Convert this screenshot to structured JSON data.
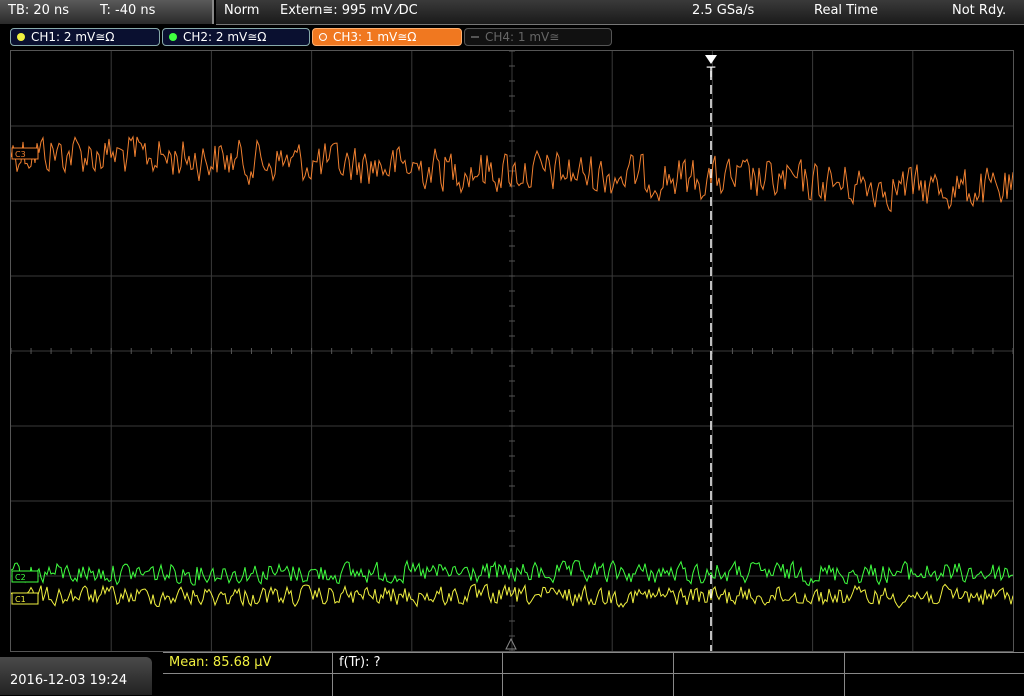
{
  "topbar": {
    "timebase": "TB: 20 ns",
    "trigger_time": "T: -40 ns",
    "trigger_mode": "Norm",
    "trigger_source": "Extern≅: 995 mV ⁄DC",
    "sample_rate": "2.5 GSa/s",
    "acquisition_mode": "Real Time",
    "ready_state": "Not Rdy."
  },
  "channels": [
    {
      "label": "CH1: 2 mV≅Ω",
      "color": "#f0f040",
      "active": true
    },
    {
      "label": "CH2: 2 mV≅Ω",
      "color": "#40ff40",
      "active": true
    },
    {
      "label": "CH3: 1 mV≅Ω",
      "color": "#f08030",
      "active": true,
      "selected": true
    },
    {
      "label": "CH4: 1 mV≅",
      "color": "#666666",
      "active": false
    }
  ],
  "markers": {
    "trigger": "T",
    "ch3_ref": "C3",
    "ch2_ref": "C2",
    "ch1_ref": "C1"
  },
  "bottom": {
    "datetime": "2016-12-03 19:24",
    "measurement_mean": "Mean: 85.68 µV",
    "measurement_freq": "f(Tr): ?"
  },
  "colors": {
    "ch1": "#f0f040",
    "ch2": "#40ff40",
    "ch3": "#f08030",
    "grid": "#3a3a3a"
  }
}
